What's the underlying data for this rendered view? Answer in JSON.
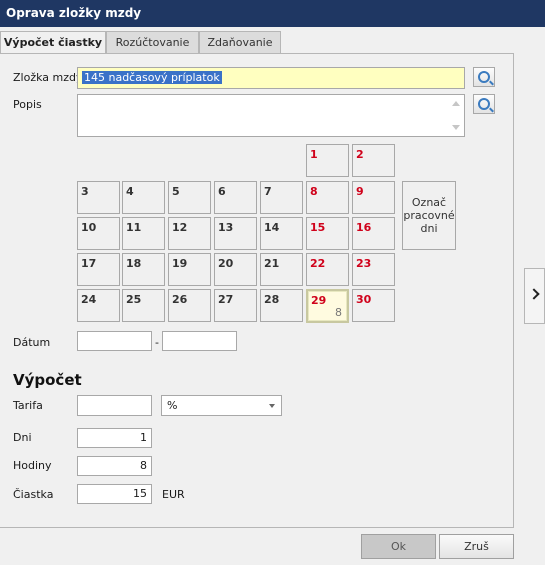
{
  "window": {
    "title": "Oprava zložky mzdy"
  },
  "tabs": [
    {
      "label": "Výpočet čiastky",
      "active": true
    },
    {
      "label": "Rozúčtovanie",
      "active": false
    },
    {
      "label": "Zdaňovanie",
      "active": false
    }
  ],
  "form": {
    "zlozka_label": "Zložka mzdy",
    "zlozka_value": "145  nadčasový príplatok",
    "popis_label": "Popis",
    "popis_value": ""
  },
  "calendar": {
    "days": [
      "1",
      "2",
      "3",
      "4",
      "5",
      "6",
      "7",
      "8",
      "9",
      "10",
      "11",
      "12",
      "13",
      "14",
      "15",
      "16",
      "17",
      "18",
      "19",
      "20",
      "21",
      "22",
      "23",
      "24",
      "25",
      "26",
      "27",
      "28",
      "29",
      "30"
    ],
    "weekend_days": [
      "1",
      "2",
      "8",
      "9",
      "15",
      "16",
      "22",
      "23",
      "29",
      "30"
    ],
    "today": "29",
    "today_hours": "8",
    "mark_button_label": "Označ pracovné dni"
  },
  "datum": {
    "label": "Dátum",
    "from": "",
    "separator": "-",
    "to": ""
  },
  "vypocet": {
    "heading": "Výpočet",
    "tarifa_label": "Tarifa",
    "tarifa_value": "",
    "unit_selected": "%",
    "dni_label": "Dni",
    "dni_value": "1",
    "hodiny_label": "Hodiny",
    "hodiny_value": "8",
    "ciastka_label": "Čiastka",
    "ciastka_value": "15",
    "currency": "EUR"
  },
  "buttons": {
    "ok": "Ok",
    "cancel": "Zruš"
  },
  "colors": {
    "titlebar": "#1f3763",
    "weekend": "#d0021b",
    "highlight": "#ffffc0",
    "selection": "#3a72c8"
  },
  "icons": {
    "lookup": "magnifier-lookup-icon",
    "expand": "chevron-right-icon"
  }
}
